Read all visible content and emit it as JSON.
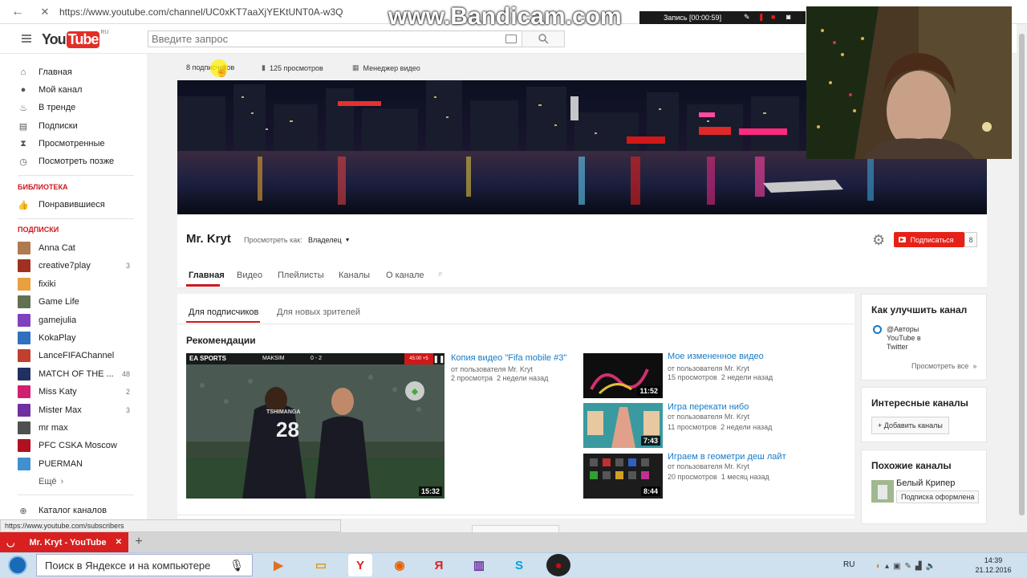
{
  "browser": {
    "url": "https://www.youtube.com/channel/UC0xKT7aaXjYEKtUNT0A-w3Q"
  },
  "recording": {
    "watermark": "www.Bandicam.com",
    "status": "Запись [00:00:59]"
  },
  "header": {
    "logo_text": "You",
    "logo_tube": "Tube",
    "region": "RU",
    "search_placeholder": "Введите запрос"
  },
  "sidebar": {
    "items": [
      {
        "label": "Главная",
        "icon": "home-icon"
      },
      {
        "label": "Мой канал",
        "icon": "user-icon"
      },
      {
        "label": "В тренде",
        "icon": "fire-icon"
      },
      {
        "label": "Подписки",
        "icon": "subscriptions-icon"
      },
      {
        "label": "Просмотренные",
        "icon": "hourglass-icon"
      },
      {
        "label": "Посмотреть позже",
        "icon": "clock-icon"
      }
    ],
    "library_heading": "БИБЛИОТЕКА",
    "library_items": [
      {
        "label": "Понравившиеся",
        "icon": "thumbs-up-icon"
      }
    ],
    "subs_heading": "ПОДПИСКИ",
    "subscriptions": [
      {
        "name": "Anna Cat",
        "count": "",
        "color": "#b07a50"
      },
      {
        "name": "creative7play",
        "count": "3",
        "color": "#a03020"
      },
      {
        "name": "fixiki",
        "count": "",
        "color": "#e9a040"
      },
      {
        "name": "Game Life",
        "count": "",
        "color": "#607050"
      },
      {
        "name": "gamejulia",
        "count": "",
        "color": "#8040c0"
      },
      {
        "name": "KokaPlay",
        "count": "",
        "color": "#3070c0"
      },
      {
        "name": "LanceFIFAChannel",
        "count": "",
        "color": "#c04030"
      },
      {
        "name": "MATCH OF THE ...",
        "count": "48",
        "color": "#203060"
      },
      {
        "name": "Miss Katy",
        "count": "2",
        "color": "#d02070"
      },
      {
        "name": "Mister Max",
        "count": "3",
        "color": "#7030a0"
      },
      {
        "name": "mr max",
        "count": "",
        "color": "#505050"
      },
      {
        "name": "PFC CSKA Moscow",
        "count": "",
        "color": "#b01020"
      },
      {
        "name": "PUERMAN",
        "count": "",
        "color": "#4090d0"
      }
    ],
    "more": "Ещё",
    "catalog": "Каталог каналов"
  },
  "channel": {
    "stats": {
      "subscribers": "8 подписчиков",
      "views": "125 просмотров",
      "manager": "Менеджер видео"
    },
    "name": "Mr. Kryt",
    "view_as_label": "Просмотреть как:",
    "view_as_value": "Владелец",
    "subscribe_label": "Подписаться",
    "subscribe_count": "8",
    "tabs": [
      "Главная",
      "Видео",
      "Плейлисты",
      "Каналы",
      "О канале"
    ]
  },
  "content": {
    "subtabs": [
      "Для подписчиков",
      "Для новых зрителей"
    ],
    "section_title": "Рекомендации",
    "featured": {
      "title": "Копия видео \"Fifa mobile #3\"",
      "author": "от пользователя Mr. Kryt",
      "views": "2 просмотра",
      "age": "2 недели назад",
      "duration": "15:32",
      "overlay_brand": "EA SPORTS",
      "overlay_team": "MAKSIM",
      "overlay_score": "0 - 2",
      "overlay_time": "45:00 +5",
      "overlay_player": "TSHIMANGA",
      "overlay_number": "28"
    },
    "videos": [
      {
        "title": "Мое измененное видео",
        "author": "от пользователя Mr. Kryt",
        "views": "15 просмотров",
        "age": "2 недели назад",
        "duration": "11:52"
      },
      {
        "title": "Игра перекати нибо",
        "author": "от пользователя Mr. Kryt",
        "views": "11 просмотров",
        "age": "2 недели назад",
        "duration": "7:43"
      },
      {
        "title": "Играем в геометри деш лайт",
        "author": "от пользователя Mr. Kryt",
        "views": "20 просмотров",
        "age": "1 месяц назад",
        "duration": "8:44"
      }
    ]
  },
  "right": {
    "improve_title": "Как улучшить канал",
    "improve_item": "@Авторы YouTube в Twitter",
    "view_all": "Просмотреть все",
    "interesting_title": "Интересные каналы",
    "add_channels": "+ Добавить каналы",
    "similar_title": "Похожие каналы",
    "similar_name": "Белый Крипер",
    "similar_btn": "Подписка оформлена"
  },
  "statusbar": {
    "url": "https://www.youtube.com/subscribers"
  },
  "browser_tab": {
    "title": "Mr. Kryt - YouTube",
    "close": "✕",
    "new": "+"
  },
  "taskbar": {
    "search": "Поиск в Яндексе и на компьютере",
    "lang": "RU",
    "time": "14:39",
    "date": "21.12.2016"
  }
}
